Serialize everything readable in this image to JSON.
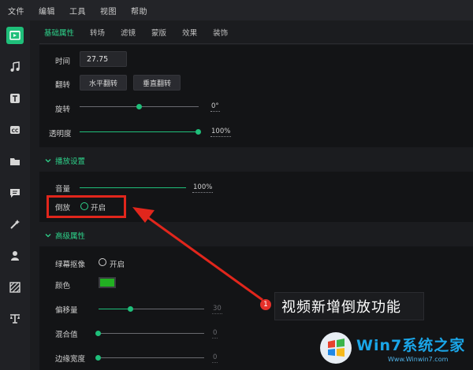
{
  "menu": [
    "文件",
    "编辑",
    "工具",
    "视图",
    "帮助"
  ],
  "rail_icons": [
    "media-icon",
    "music-icon",
    "text-icon",
    "caption-icon",
    "folder-icon",
    "comment-icon",
    "magic-wand-icon",
    "person-icon",
    "stripes-icon",
    "filter-icon"
  ],
  "tabs": [
    "基础属性",
    "转场",
    "滤镜",
    "蒙版",
    "效果",
    "装饰"
  ],
  "basic": {
    "time_label": "时间",
    "time_value": "27.75",
    "flip_label": "翻转",
    "flip_h": "水平翻转",
    "flip_v": "垂直翻转",
    "rotate_label": "旋转",
    "rotate_value": "0°",
    "rotate_level": 0.5,
    "opacity_label": "透明度",
    "opacity_value": "100%",
    "opacity_level": 1.0
  },
  "playback": {
    "title": "播放设置",
    "volume_label": "音量",
    "volume_value": "100%",
    "volume_level": 1.0,
    "reverse_label": "倒放",
    "reverse_option": "开启"
  },
  "advanced": {
    "title": "高级属性",
    "chroma_label": "绿幕抠像",
    "chroma_option": "开启",
    "color_label": "颜色",
    "color_value": "#22b022",
    "offset_label": "偏移量",
    "offset_value": "30",
    "offset_level": 0.3,
    "blend_label": "混合值",
    "blend_value": "0",
    "blend_level": 0.0,
    "edge_label": "边缘宽度",
    "edge_value": "0",
    "edge_level": 0.0
  },
  "annotation": {
    "badge": "1",
    "text": "视频新增倒放功能"
  },
  "watermark": {
    "text": "Win7系统之家",
    "url": "Www.Winwin7.com"
  },
  "colors": {
    "accent": "#1fbf7a",
    "highlight_red": "#e1261c"
  }
}
